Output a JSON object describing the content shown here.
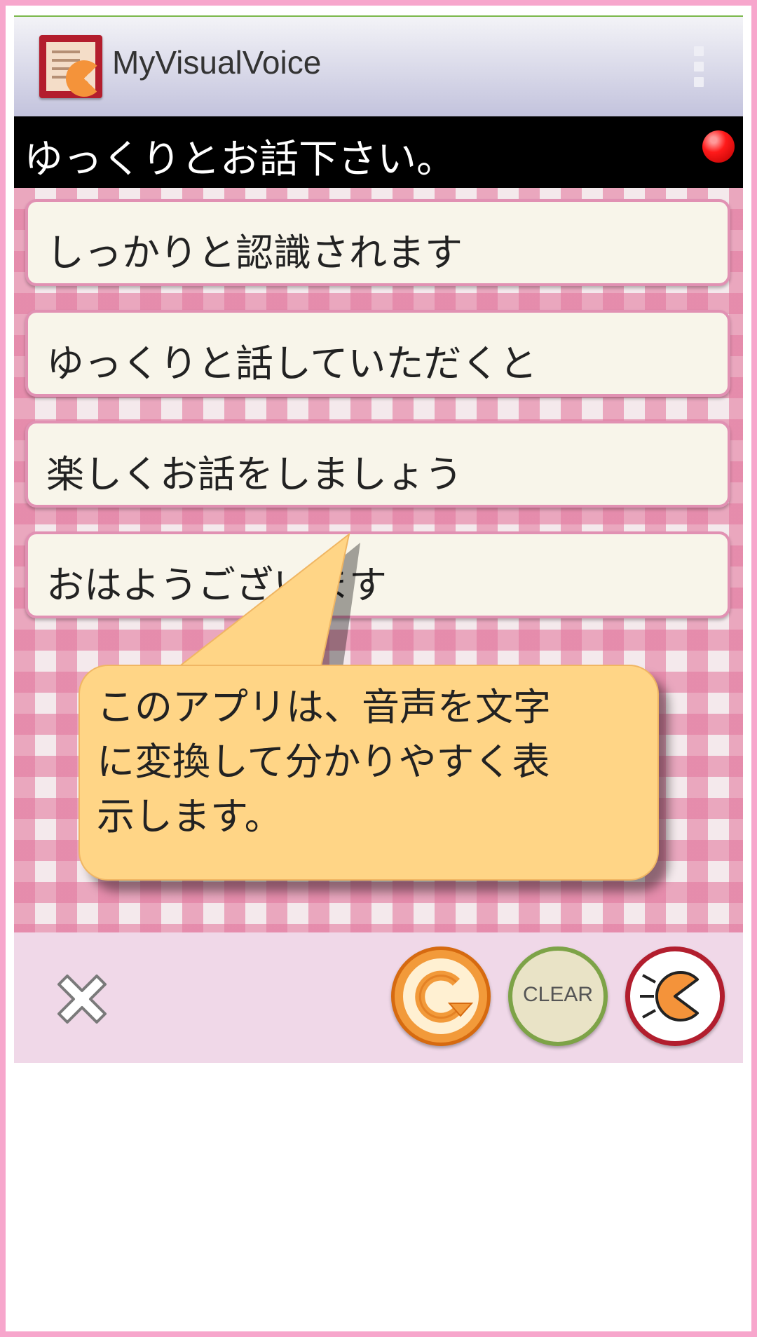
{
  "app_bar": {
    "title": "MyVisualVoice",
    "logo_icon": "app-logo-icon",
    "menu_icon": "overflow-menu-icon"
  },
  "status": {
    "message": "ゆっくりとお話下さい。",
    "indicator": "recording-indicator",
    "indicator_color": "#ff1a1a"
  },
  "transcripts": [
    "しっかりと認識されます",
    "ゆっくりと話していただくと",
    "楽しくお話をしましょう",
    "おはようございます"
  ],
  "tooltip": {
    "lines": [
      "このアプリは、音声を文字",
      "に変換して分かりやすく表",
      "示します。"
    ]
  },
  "toolbar": {
    "close_icon": "close-icon",
    "replay_icon": "replay-icon",
    "clear_label": "CLEAR",
    "speak_icon": "speak-icon"
  },
  "colors": {
    "frame": "#f7a6cc",
    "status_bar": "#000000",
    "card_border": "#e191b3",
    "bubble": "#ffd586",
    "toolbar": "#f0d8e8"
  }
}
